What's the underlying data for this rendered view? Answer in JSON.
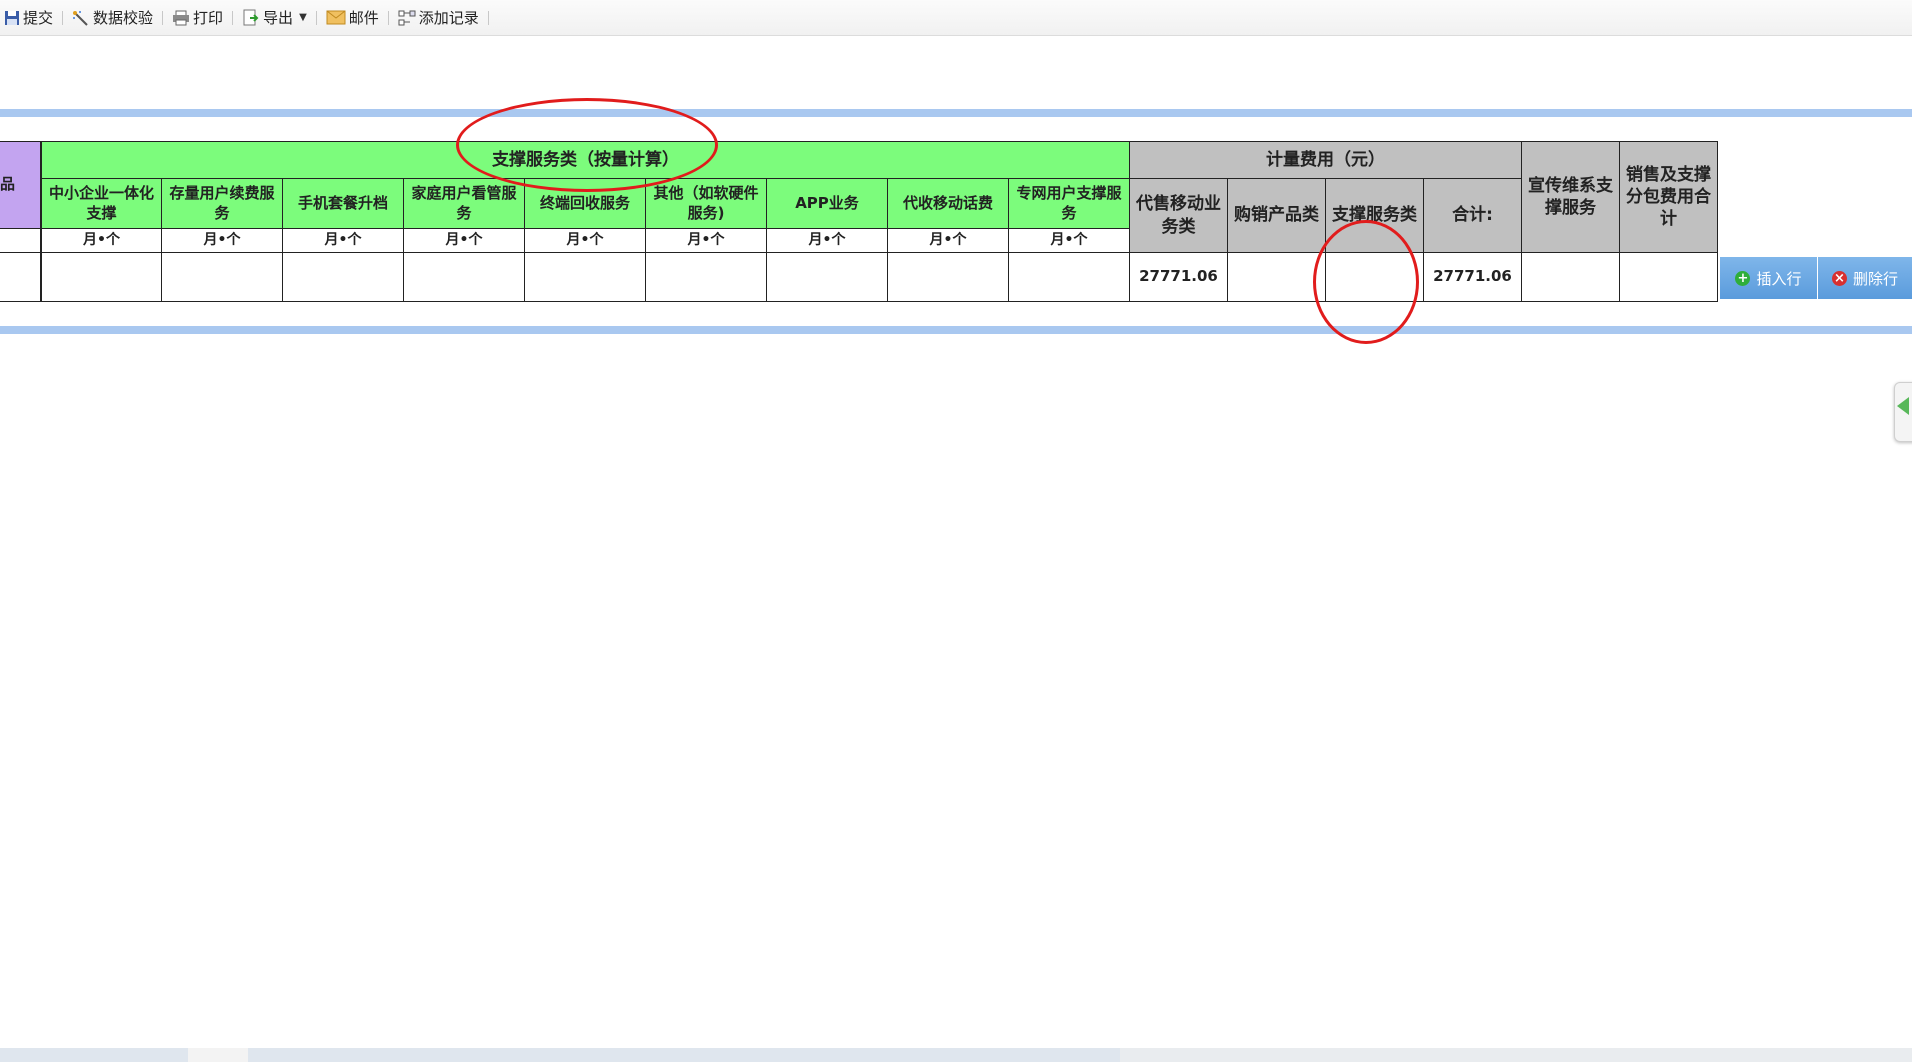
{
  "toolbar": {
    "submit": "提交",
    "validate": "数据校验",
    "print": "打印",
    "export": "导出",
    "mail": "邮件",
    "add_record": "添加记录"
  },
  "table": {
    "left_cut_label": "品",
    "group_support": "支撑服务类（按量计算）",
    "group_metered": "计量费用（元）",
    "col_publicity": "宣传维系支撑服务",
    "col_sales_total": "销售及支撑分包费用合计",
    "support_columns": [
      {
        "label": "中小企业一体化支撑",
        "unit": "月•个"
      },
      {
        "label": "存量用户续费服务",
        "unit": "月•个"
      },
      {
        "label": "手机套餐升档",
        "unit": "月•个"
      },
      {
        "label": "家庭用户看管服务",
        "unit": "月•个"
      },
      {
        "label": "终端回收服务",
        "unit": "月•个"
      },
      {
        "label": "其他（如软硬件服务)",
        "unit": "月•个"
      },
      {
        "label": "APP业务",
        "unit": "月•个"
      },
      {
        "label": "代收移动话费",
        "unit": "月•个"
      },
      {
        "label": "专网用户支撑服务",
        "unit": "月•个"
      }
    ],
    "metered_columns": [
      "代售移动业务类",
      "购销产品类",
      "支撑服务类",
      "合计:"
    ],
    "row": {
      "agency_mobile": "27771.06",
      "purchase_sales": "",
      "support_service": "",
      "total": "27771.06",
      "publicity": "",
      "sales_total": ""
    }
  },
  "actions": {
    "insert_row": "插入行",
    "delete_row": "删除行"
  },
  "colors": {
    "green_header": "#7cfc7c",
    "grey_header": "#c0c0c0",
    "purple_header": "#c3a4f0",
    "band": "#a9c8f0",
    "annotation": "#e11c1c",
    "action_button": "#5a9bdc"
  }
}
